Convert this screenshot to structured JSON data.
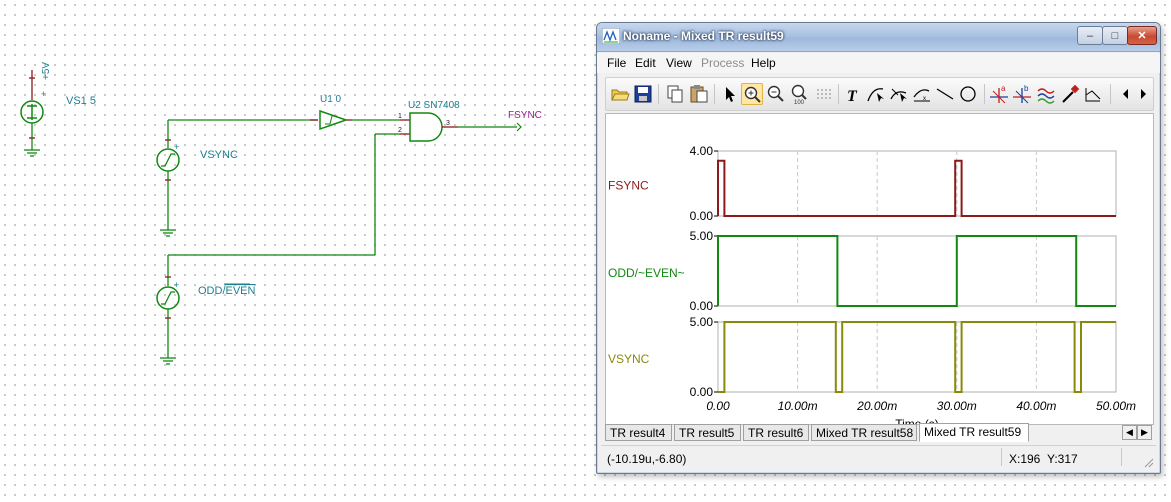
{
  "schematic": {
    "vs1_voltage": "+5V",
    "vs1_label": "VS1 5",
    "vsync_source": "VSYNC",
    "oddeven_source_prefix": "ODD/",
    "oddeven_source_bar": "EVEN",
    "u1_label": "U1 0",
    "u2_label": "U2 SN7408",
    "pin1": "1",
    "pin2": "2",
    "pin3": "3",
    "output_label": "FSYNC",
    "plus": "+"
  },
  "window": {
    "title": "Noname - Mixed TR result59",
    "min_glyph": "–",
    "max_glyph": "□",
    "close_glyph": "✕"
  },
  "menu": {
    "file": "File",
    "edit": "Edit",
    "view": "View",
    "process": "Process",
    "help": "Help"
  },
  "toolbar": {
    "items": [
      "open-folder-icon",
      "save-icon",
      "copy-icon",
      "paste-icon",
      "pointer-icon",
      "zoom-in-icon",
      "zoom-out-icon",
      "zoom-100-icon",
      "grid-icon",
      "text-icon",
      "cursor-a-icon",
      "cursor-b-icon",
      "curve-icon",
      "line-icon",
      "circle-icon",
      "marker-a-icon",
      "marker-b-icon",
      "waves-icon",
      "probe-icon",
      "slope-icon"
    ]
  },
  "chart_data": {
    "type": "line",
    "xlabel": "Time (s)",
    "xlim": [
      0,
      0.05
    ],
    "x_ticks": [
      "0.00",
      "10.00m",
      "20.00m",
      "30.00m",
      "40.00m",
      "50.00m"
    ],
    "grid": true,
    "series": [
      {
        "name": "FSYNC",
        "color": "#8b1a1a",
        "ylim": [
          0,
          4
        ],
        "y_ticks": [
          "4.00",
          "0.00"
        ],
        "x": [
          0,
          0,
          0.0008,
          0.0008,
          0.0298,
          0.0298,
          0.0306,
          0.0306,
          0.05
        ],
        "y": [
          0,
          3.4,
          3.4,
          0,
          0,
          3.4,
          3.4,
          0,
          0
        ]
      },
      {
        "name": "ODD/~EVEN~",
        "color": "#118811",
        "ylim": [
          0,
          5
        ],
        "y_ticks": [
          "5.00",
          "0.00"
        ],
        "x": [
          0,
          0,
          0.015,
          0.015,
          0.03,
          0.03,
          0.045,
          0.045,
          0.05
        ],
        "y": [
          0,
          5,
          5,
          0,
          0,
          5,
          5,
          0,
          0
        ]
      },
      {
        "name": "VSYNC",
        "color": "#8a8a0a",
        "ylim": [
          0,
          5
        ],
        "y_ticks": [
          "5.00",
          "0.00"
        ],
        "x": [
          0,
          0,
          0.0008,
          0.0008,
          0.0148,
          0.0148,
          0.0156,
          0.0156,
          0.0298,
          0.0298,
          0.0306,
          0.0306,
          0.0448,
          0.0448,
          0.0456,
          0.0456,
          0.05
        ],
        "y": [
          0,
          0,
          0,
          5,
          5,
          0,
          0,
          5,
          5,
          0,
          0,
          5,
          5,
          0,
          0,
          5,
          5
        ]
      }
    ]
  },
  "tabs": [
    "TR result4",
    "TR result5",
    "TR result6",
    "Mixed TR result58",
    "Mixed TR result59"
  ],
  "tab_arrows": {
    "left": "◀",
    "right": "▶"
  },
  "status": {
    "coords": "(-10.19u,-6.80)",
    "x_label": "X:196",
    "y_label": "Y:317"
  }
}
